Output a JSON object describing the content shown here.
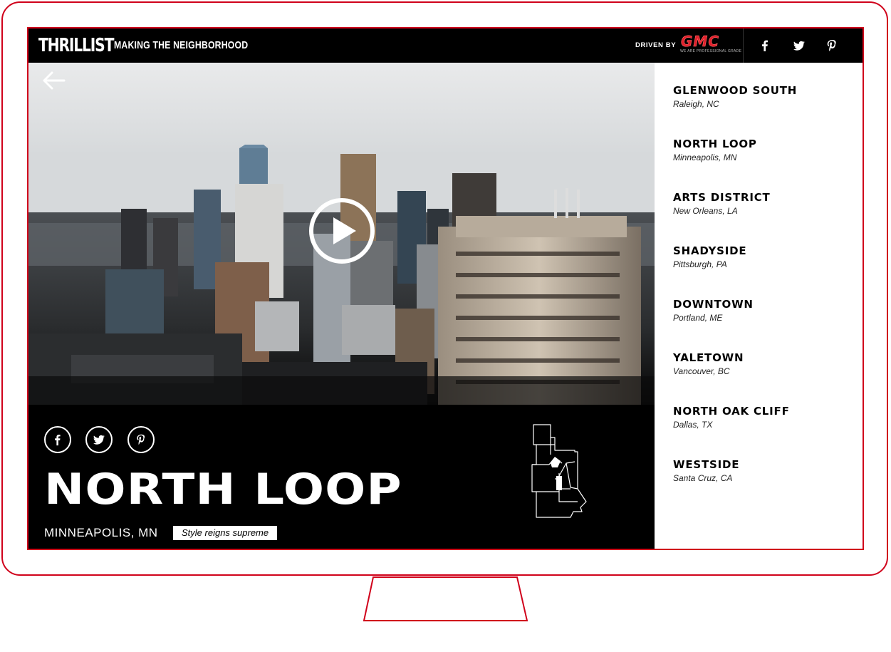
{
  "header": {
    "logo": "THRILLIST",
    "tagline": "MAKING THE NEIGHBORHOOD",
    "driven_by": "DRIVEN BY",
    "sponsor": "GMC",
    "sponsor_sub": "WE ARE PROFESSIONAL GRADE",
    "social": [
      "facebook-icon",
      "twitter-icon",
      "pinterest-icon"
    ]
  },
  "feature": {
    "title": "NORTH LOOP",
    "city": "MINNEAPOLIS, MN",
    "tag": "Style reigns supreme",
    "share": [
      "facebook-icon",
      "twitter-icon",
      "pinterest-icon"
    ]
  },
  "neighborhoods": [
    {
      "name": "GLENWOOD SOUTH",
      "location": "Raleigh, NC"
    },
    {
      "name": "NORTH LOOP",
      "location": "Minneapolis, MN"
    },
    {
      "name": "ARTS DISTRICT",
      "location": "New Orleans, LA"
    },
    {
      "name": "SHADYSIDE",
      "location": "Pittsburgh, PA"
    },
    {
      "name": "DOWNTOWN",
      "location": "Portland, ME"
    },
    {
      "name": "YALETOWN",
      "location": "Vancouver, BC"
    },
    {
      "name": "NORTH OAK CLIFF",
      "location": "Dallas, TX"
    },
    {
      "name": "WESTSIDE",
      "location": "Santa Cruz, CA"
    }
  ],
  "colors": {
    "accent": "#d0021b",
    "brand_gmc": "#e0202b"
  }
}
